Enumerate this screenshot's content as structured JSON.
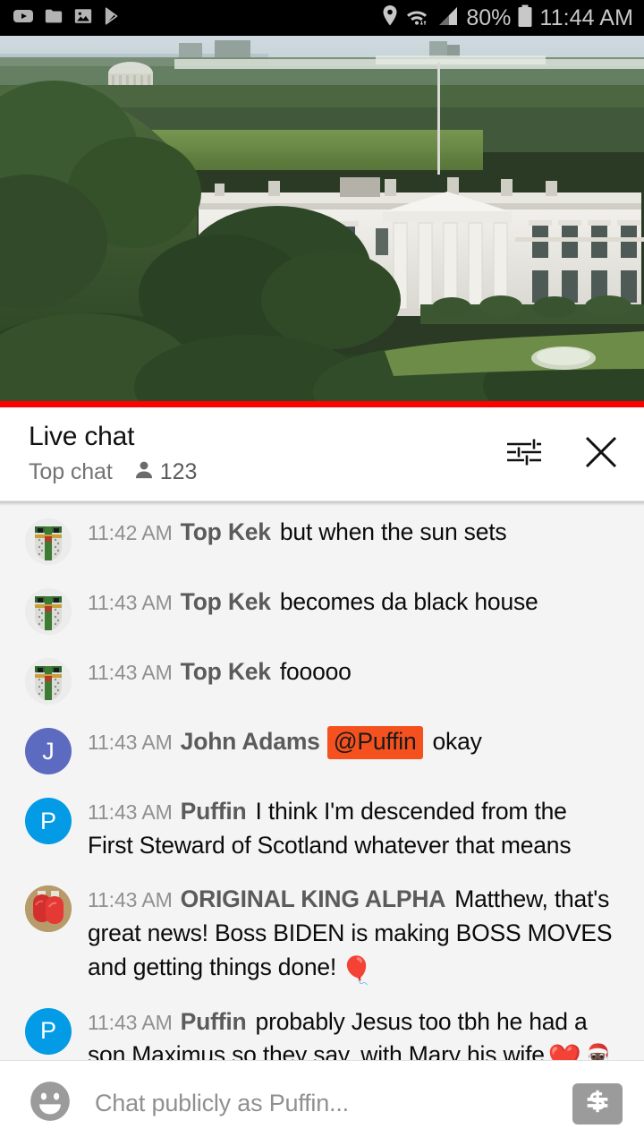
{
  "statusbar": {
    "left_icons": [
      "youtube-icon",
      "folder-icon",
      "image-icon",
      "play-store-icon"
    ],
    "right_icons": [
      "location-icon",
      "wifi-icon",
      "signal-icon",
      "battery-icon"
    ],
    "battery_percent": "80%",
    "clock": "11:44 AM"
  },
  "video": {
    "name": "white-house-live-stream",
    "progress_color": "#ff0000",
    "progress_percent": 100
  },
  "chat_header": {
    "title": "Live chat",
    "mode": "Top chat",
    "viewer_count": "123",
    "viewer_icon": "person-icon",
    "filter_icon": "tune-icon",
    "close_icon": "close-icon"
  },
  "messages": [
    {
      "time": "11:42 AM",
      "author": "Top Kek",
      "text": "but when the sun sets",
      "avatar_kind": "templar",
      "avatar_letter": "",
      "avatar_color": "#e9e9ea",
      "mention": "",
      "emojis": ""
    },
    {
      "time": "11:43 AM",
      "author": "Top Kek",
      "text": "becomes da black house",
      "avatar_kind": "templar",
      "avatar_letter": "",
      "avatar_color": "#e9e9ea",
      "mention": "",
      "emojis": ""
    },
    {
      "time": "11:43 AM",
      "author": "Top Kek",
      "text": "fooooo",
      "avatar_kind": "templar",
      "avatar_letter": "",
      "avatar_color": "#e9e9ea",
      "mention": "",
      "emojis": ""
    },
    {
      "time": "11:43 AM",
      "author": "John Adams",
      "text": "okay",
      "avatar_kind": "letter",
      "avatar_letter": "J",
      "avatar_color": "#5c6bc0",
      "mention": "@Puffin",
      "emojis": ""
    },
    {
      "time": "11:43 AM",
      "author": "Puffin",
      "text": "I think I'm descended from the First Steward of Scotland whatever that means",
      "avatar_kind": "letter",
      "avatar_letter": "P",
      "avatar_color": "#039be5",
      "mention": "",
      "emojis": ""
    },
    {
      "time": "11:43 AM",
      "author": "ORIGINAL KING ALPHA",
      "text": "Matthew, that's great news! Boss BIDEN is making BOSS MOVES and getting things done!",
      "avatar_kind": "gloves",
      "avatar_letter": "",
      "avatar_color": "#b79b6a",
      "mention": "",
      "emojis": "🎈"
    },
    {
      "time": "11:43 AM",
      "author": "Puffin",
      "text": "probably Jesus too tbh he had a son Maximus so they say, with Mary his wife",
      "avatar_kind": "letter",
      "avatar_letter": "P",
      "avatar_color": "#039be5",
      "mention": "",
      "emojis": "❤️🎅🏿"
    }
  ],
  "composer": {
    "emoji_icon": "emoji-smiley-icon",
    "placeholder": "Chat publicly as Puffin...",
    "value": "",
    "superchat_icon": "dollar-icon"
  },
  "colors": {
    "accent_red": "#ff0000",
    "mention_bg": "#f4511e",
    "chat_bg": "#f4f4f4",
    "statusbar_bg": "#000000"
  }
}
